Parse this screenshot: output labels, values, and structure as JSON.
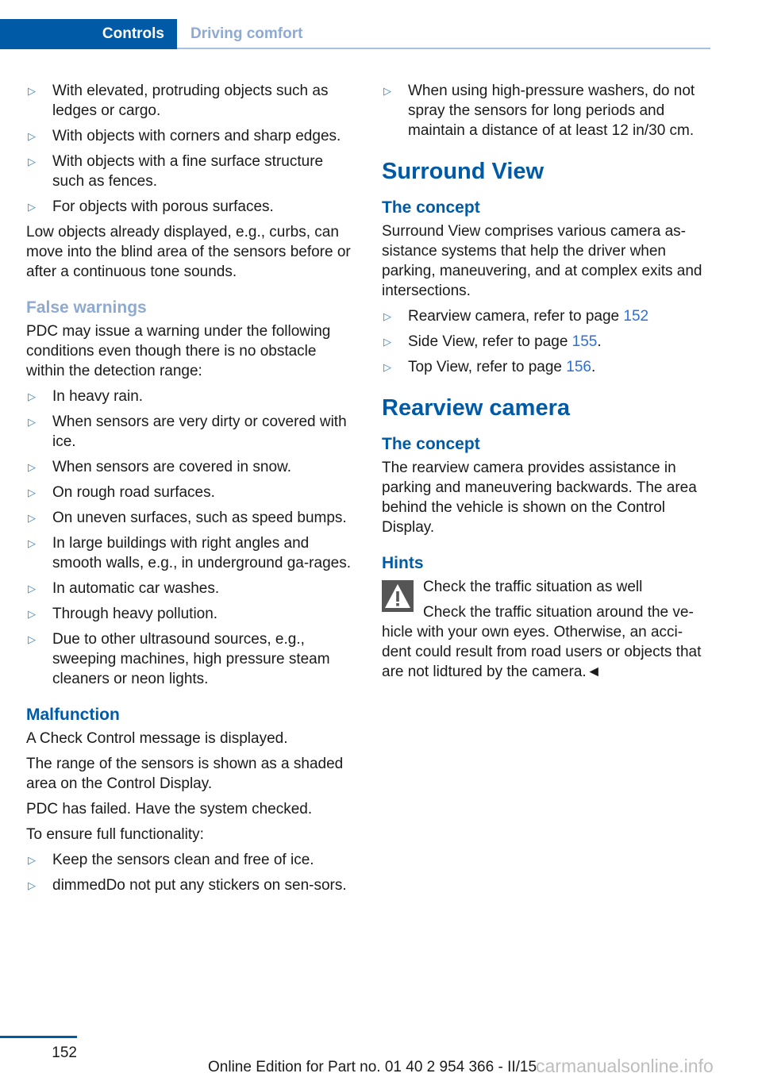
{
  "header": {
    "section_tab": "Controls",
    "chapter_tab": "Driving comfort"
  },
  "colors": {
    "brand_blue": "#005aa6",
    "light_heading": "#8eaad2",
    "bullet": "#2f7fc6",
    "link": "#2f6fd6"
  },
  "left_column": {
    "limits_list": [
      "With elevated, protruding objects such as ledges or cargo.",
      "With objects with corners and sharp edges.",
      "With objects with a fine surface structure such as fences.",
      "For objects with porous surfaces."
    ],
    "low_objects_text": "Low objects already displayed, e.g., curbs, can move into the blind area of the sensors before or after a continuous tone sounds.",
    "false_warnings": {
      "heading": "False warnings",
      "intro": "PDC may issue a warning under the following conditions even though there is no obstacle within the detection range:",
      "items": [
        "In heavy rain.",
        "When sensors are very dirty or covered with ice.",
        "When sensors are covered in snow.",
        "On rough road surfaces.",
        "On uneven surfaces, such as speed bumps.",
        "In large buildings with right angles and smooth walls, e.g., in underground ga-rages.",
        "In automatic car washes.",
        "Through heavy pollution.",
        "Due to other ultrasound sources, e.g., sweeping machines, high pressure steam cleaners or neon lights."
      ]
    },
    "malfunction": {
      "heading": "Malfunction",
      "paragraphs": [
        "A Check Control message is displayed.",
        "The range of the sensors is shown as a shaded area on the Control Display.",
        "PDC has failed. Have the system checked.",
        "To ensure full functionality:"
      ],
      "items": [
        "Keep the sensors clean and free of ice.",
        "dimmedDo not put any stickers on sen-sors."
      ]
    }
  },
  "right_column": {
    "washer_item": "When using high-pressure washers, do not spray the sensors for long periods and maintain a distance of at least 12 in/30 cm.",
    "surround_view": {
      "heading": "Surround View",
      "concept_heading": "The concept",
      "concept_text": "Surround View comprises various camera as-sistance systems that help the driver when parking, maneuvering, and at complex exits and intersections.",
      "refs": [
        {
          "text": "Rearview camera, refer to page ",
          "page": "152",
          "suffix": ""
        },
        {
          "text": "Side View, refer to page ",
          "page": "155",
          "suffix": "."
        },
        {
          "text": "Top View, refer to page ",
          "page": "156",
          "suffix": "."
        }
      ]
    },
    "rearview_camera": {
      "heading": "Rearview camera",
      "concept_heading": "The concept",
      "concept_text": "The rearview camera provides assistance in parking and maneuvering backwards. The area behind the vehicle is shown on the Control Display.",
      "hints_heading": "Hints",
      "warning_title": "Check the traffic situation as well",
      "warning_text": "Check the traffic situation around the ve-hicle with your own eyes. Otherwise, an acci-dent could result from road users or objects that are not lidtured by the camera.",
      "end_mark": "◄"
    }
  },
  "bullet_glyph": "▷",
  "footer": {
    "page_number": "152",
    "edition": "Online Edition for Part no. 01 40 2 954 366 - II/15",
    "watermark": "carmanualsonline.info"
  }
}
